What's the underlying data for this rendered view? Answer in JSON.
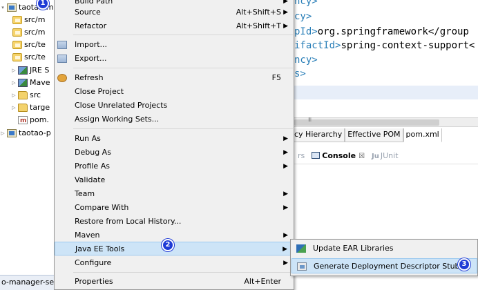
{
  "explorer": {
    "items": [
      {
        "label": "taotao-m",
        "indent": 0,
        "twisty": "▾",
        "icon": "project-icon"
      },
      {
        "label": "src/m",
        "indent": 1,
        "twisty": "",
        "icon": "source-folder-icon"
      },
      {
        "label": "src/m",
        "indent": 1,
        "twisty": "",
        "icon": "source-folder-icon"
      },
      {
        "label": "src/te",
        "indent": 1,
        "twisty": "",
        "icon": "source-folder-icon"
      },
      {
        "label": "src/te",
        "indent": 1,
        "twisty": "",
        "icon": "source-folder-icon"
      },
      {
        "label": "JRE S",
        "indent": 1,
        "twisty": "▷",
        "icon": "library-icon"
      },
      {
        "label": "Mave",
        "indent": 1,
        "twisty": "▷",
        "icon": "library-icon"
      },
      {
        "label": "src",
        "indent": 1,
        "twisty": "▷",
        "icon": "folder-icon"
      },
      {
        "label": "targe",
        "indent": 1,
        "twisty": "▷",
        "icon": "folder-icon"
      },
      {
        "label": "pom.",
        "indent": 1,
        "twisty": "",
        "icon": "pom-file-icon"
      },
      {
        "label": "taotao-p",
        "indent": 0,
        "twisty": "▷",
        "icon": "project-icon"
      }
    ],
    "bottom_tab": "o-manager-se"
  },
  "editor": {
    "lines": [
      {
        "tag": "ncy>",
        "text": ""
      },
      {
        "tag": "cy>",
        "text": ""
      },
      {
        "tag": "pId>",
        "text": "org.springframework</group"
      },
      {
        "tag": "ifactId>",
        "text": "spring-context-support<"
      },
      {
        "tag": "ncy>",
        "text": ""
      },
      {
        "tag": "s>",
        "text": ""
      }
    ],
    "pom_tabs": [
      "cy Hierarchy",
      "Effective POM",
      "pom.xml"
    ],
    "view_tabs": {
      "servers": "rs",
      "console": "Console",
      "console_close": "☒",
      "junit_prefix": "Ju",
      "junit": "JUnit"
    }
  },
  "context_menu": {
    "items": [
      {
        "label": "Build Path",
        "shortcut": "",
        "submenu": true
      },
      {
        "label": "Source",
        "shortcut": "Alt+Shift+S",
        "submenu": true
      },
      {
        "label": "Refactor",
        "shortcut": "Alt+Shift+T",
        "submenu": true
      },
      {
        "label": "Import...",
        "shortcut": "",
        "submenu": false,
        "icon": "import-icon"
      },
      {
        "label": "Export...",
        "shortcut": "",
        "submenu": false,
        "icon": "export-icon"
      },
      {
        "label": "Refresh",
        "shortcut": "F5",
        "submenu": false,
        "icon": "refresh-icon"
      },
      {
        "label": "Close Project",
        "shortcut": "",
        "submenu": false
      },
      {
        "label": "Close Unrelated Projects",
        "shortcut": "",
        "submenu": false
      },
      {
        "label": "Assign Working Sets...",
        "shortcut": "",
        "submenu": false
      },
      {
        "label": "Run As",
        "shortcut": "",
        "submenu": true
      },
      {
        "label": "Debug As",
        "shortcut": "",
        "submenu": true
      },
      {
        "label": "Profile As",
        "shortcut": "",
        "submenu": true
      },
      {
        "label": "Validate",
        "shortcut": "",
        "submenu": false
      },
      {
        "label": "Team",
        "shortcut": "",
        "submenu": true
      },
      {
        "label": "Compare With",
        "shortcut": "",
        "submenu": true
      },
      {
        "label": "Restore from Local History...",
        "shortcut": "",
        "submenu": false
      },
      {
        "label": "Maven",
        "shortcut": "",
        "submenu": true
      },
      {
        "label": "Java EE Tools",
        "shortcut": "",
        "submenu": true,
        "highlighted": true
      },
      {
        "label": "Configure",
        "shortcut": "",
        "submenu": true
      },
      {
        "label": "Properties",
        "shortcut": "Alt+Enter",
        "submenu": false
      }
    ],
    "submenu_arrow": "▶"
  },
  "submenu": {
    "items": [
      {
        "label": "Update EAR Libraries",
        "icon": "ear-libraries-icon"
      },
      {
        "label": "Generate Deployment Descriptor Stub",
        "icon": "descriptor-stub-icon",
        "highlighted": true
      }
    ]
  },
  "callouts": [
    "1",
    "2",
    "3"
  ],
  "colors": {
    "menu_bg": "#f0f0f0",
    "highlight": "#cde4f7",
    "xml_tag": "#2a7fb8",
    "callout": "#1f3bd6"
  }
}
